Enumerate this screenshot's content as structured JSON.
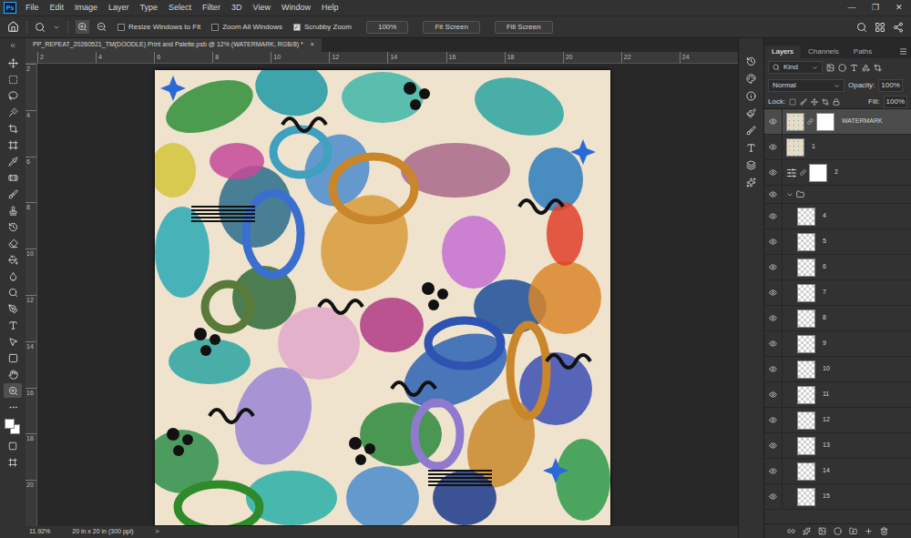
{
  "app": {
    "logo": "Ps",
    "menu": [
      "File",
      "Edit",
      "Image",
      "Layer",
      "Type",
      "Select",
      "Filter",
      "3D",
      "View",
      "Window",
      "Help"
    ],
    "window_controls": [
      "—",
      "❐",
      "✕"
    ]
  },
  "options_bar": {
    "checkboxes": [
      {
        "label": "Resize Windows to Fit",
        "checked": false
      },
      {
        "label": "Zoom All Windows",
        "checked": false
      },
      {
        "label": "Scrubby Zoom",
        "checked": true
      }
    ],
    "buttons": [
      "100%",
      "Fit Screen",
      "Fill Screen"
    ]
  },
  "document": {
    "tab_title": "PP_REPEAT_20260521_TM(DOODLE) Print and Palette.psb @ 12% (WATERMARK, RGB/8) *",
    "close": "×",
    "ruler_h": [
      "2",
      "4",
      "6",
      "8",
      "10",
      "12",
      "14",
      "16",
      "18",
      "20",
      "22",
      "24"
    ],
    "ruler_v": [
      "2",
      "4",
      "6",
      "8",
      "10",
      "12",
      "14",
      "16",
      "18",
      "20"
    ],
    "zoom": "11.92%",
    "size": "20 in x 20 in (300 ppi)",
    "status_arrow": ">"
  },
  "tools": [
    {
      "selected": false
    },
    {
      "selected": false
    },
    {
      "selected": false
    },
    {
      "selected": false
    },
    {
      "selected": false
    },
    {
      "selected": false
    },
    {
      "selected": false
    },
    {
      "selected": false
    },
    {
      "selected": false
    },
    {
      "selected": false
    },
    {
      "selected": false
    },
    {
      "selected": false
    },
    {
      "selected": false
    },
    {
      "selected": false
    },
    {
      "selected": false
    },
    {
      "selected": false
    },
    {
      "selected": false
    },
    {
      "selected": false
    },
    {
      "selected": false
    },
    {
      "selected": false
    },
    {
      "selected": true
    },
    {
      "selected": false
    }
  ],
  "layers_panel": {
    "tabs": [
      {
        "label": "Layers",
        "selected": true
      },
      {
        "label": "Channels",
        "selected": false
      },
      {
        "label": "Paths",
        "selected": false
      }
    ],
    "filter": "Kind",
    "blend_mode": "Normal",
    "opacity_label": "Opacity:",
    "opacity": "100%",
    "lock_label": "Lock:",
    "fill_label": "Fill:",
    "fill": "100%",
    "layers": [
      {
        "name": "WATERMARK",
        "kind": "pattern",
        "visible": true,
        "selected": true,
        "mask": true,
        "in_group": false
      },
      {
        "name": "1",
        "kind": "pattern",
        "visible": true,
        "selected": false,
        "mask": false,
        "in_group": false
      },
      {
        "name": "2",
        "kind": "adjustment",
        "visible": true,
        "selected": false,
        "mask": true,
        "in_group": false
      },
      {
        "name": "",
        "kind": "group",
        "visible": true,
        "selected": false,
        "mask": false,
        "in_group": false
      },
      {
        "name": "4",
        "kind": "layer",
        "visible": true,
        "selected": false,
        "mask": false,
        "in_group": true
      },
      {
        "name": "5",
        "kind": "layer",
        "visible": true,
        "selected": false,
        "mask": false,
        "in_group": true
      },
      {
        "name": "6",
        "kind": "layer",
        "visible": true,
        "selected": false,
        "mask": false,
        "in_group": true
      },
      {
        "name": "7",
        "kind": "layer",
        "visible": true,
        "selected": false,
        "mask": false,
        "in_group": true
      },
      {
        "name": "8",
        "kind": "layer",
        "visible": true,
        "selected": false,
        "mask": false,
        "in_group": true
      },
      {
        "name": "9",
        "kind": "layer",
        "visible": true,
        "selected": false,
        "mask": false,
        "in_group": true
      },
      {
        "name": "10",
        "kind": "layer",
        "visible": true,
        "selected": false,
        "mask": false,
        "in_group": true
      },
      {
        "name": "11",
        "kind": "layer",
        "visible": true,
        "selected": false,
        "mask": false,
        "in_group": true
      },
      {
        "name": "12",
        "kind": "layer",
        "visible": true,
        "selected": false,
        "mask": false,
        "in_group": true
      },
      {
        "name": "13",
        "kind": "layer",
        "visible": true,
        "selected": false,
        "mask": false,
        "in_group": true
      },
      {
        "name": "14",
        "kind": "layer",
        "visible": true,
        "selected": false,
        "mask": false,
        "in_group": true
      },
      {
        "name": "15",
        "kind": "layer",
        "visible": true,
        "selected": false,
        "mask": false,
        "in_group": true
      }
    ]
  }
}
